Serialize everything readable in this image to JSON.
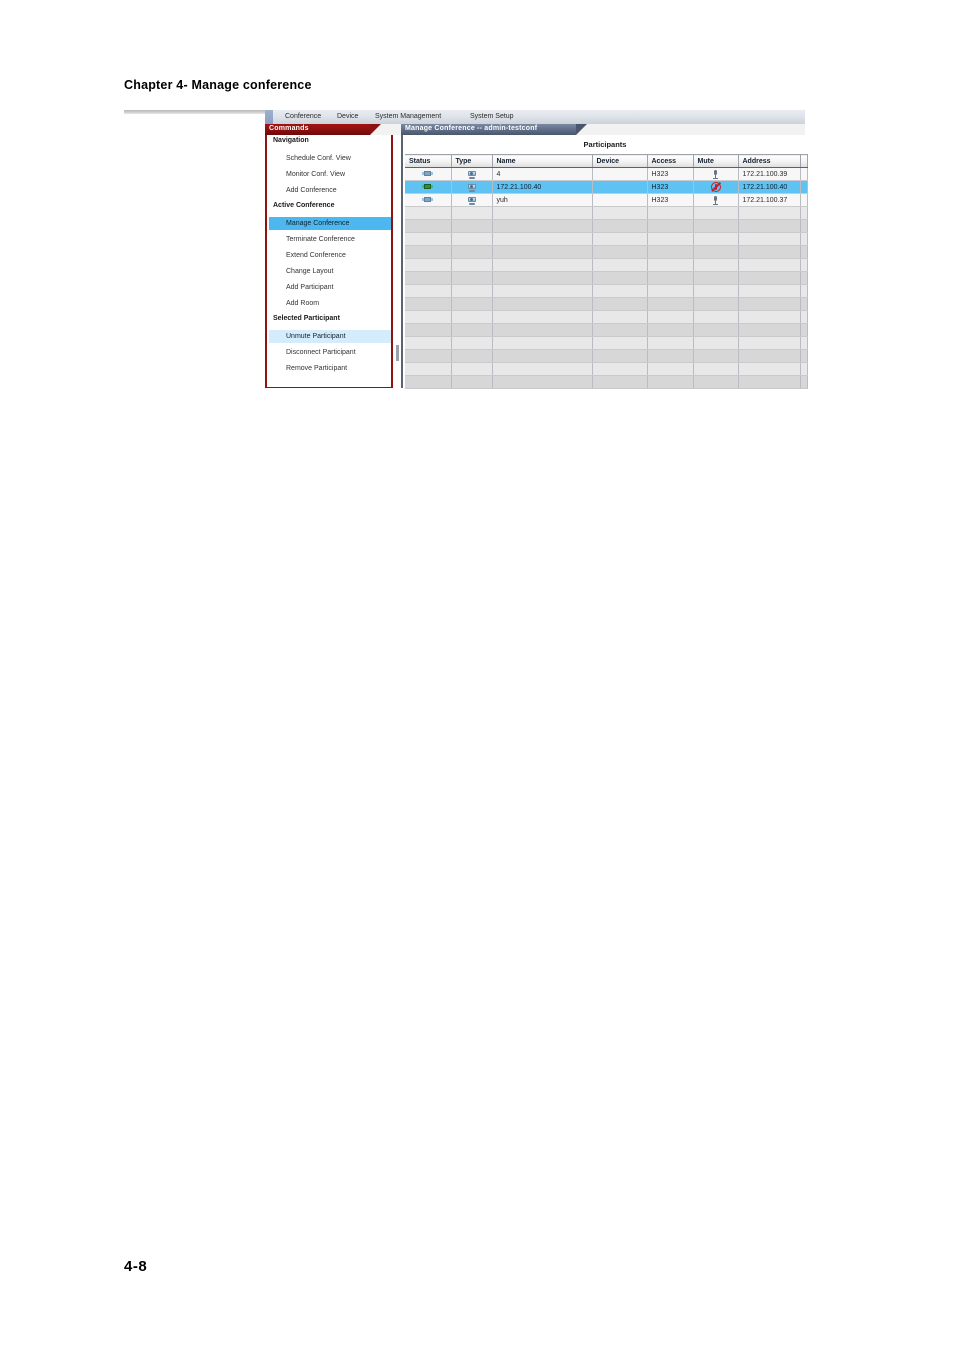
{
  "page": {
    "chapter_title": "Chapter 4- Manage conference",
    "page_number": "4-8"
  },
  "app": {
    "menubar": {
      "items": [
        {
          "label": "Conference"
        },
        {
          "label": "Device"
        },
        {
          "label": "System Management"
        },
        {
          "label": "System Setup"
        }
      ]
    },
    "tabs": {
      "commands": "Commands",
      "content": "Manage Conference -- admin-testconf"
    },
    "commands_panel": {
      "groups": [
        {
          "title": "Navigation",
          "items": [
            {
              "label": "Schedule Conf. View",
              "state": "normal"
            },
            {
              "label": "Monitor Conf. View",
              "state": "normal"
            },
            {
              "label": "Add Conference",
              "state": "normal"
            }
          ]
        },
        {
          "title": "Active Conference",
          "items": [
            {
              "label": "Manage Conference",
              "state": "selected"
            },
            {
              "label": "Terminate Conference",
              "state": "normal"
            },
            {
              "label": "Extend Conference",
              "state": "normal"
            },
            {
              "label": "Change Layout",
              "state": "normal"
            },
            {
              "label": "Add Participant",
              "state": "normal"
            },
            {
              "label": "Add Room",
              "state": "normal"
            }
          ]
        },
        {
          "title": "Selected Participant",
          "items": [
            {
              "label": "Unmute Participant",
              "state": "highlight"
            },
            {
              "label": "Disconnect Participant",
              "state": "normal"
            },
            {
              "label": "Remove Participant",
              "state": "normal"
            }
          ]
        }
      ]
    },
    "content_panel": {
      "caption": "Participants",
      "table": {
        "columns": [
          "Status",
          "Type",
          "Name",
          "Device",
          "Access",
          "Mute",
          "Address",
          ""
        ],
        "rows": [
          {
            "status_icon": "connected-dim-icon",
            "type_icon": "endpoint-device-icon",
            "name": "4",
            "device": "",
            "access": "H323",
            "mute_icon": "microphone-icon",
            "address": "172.21.100.39",
            "selected": false
          },
          {
            "status_icon": "connected-green-icon",
            "type_icon": "endpoint-device-icon",
            "name": "172.21.100.40",
            "device": "",
            "access": "H323",
            "mute_icon": "muted-icon",
            "address": "172.21.100.40",
            "selected": true
          },
          {
            "status_icon": "connected-dim-icon",
            "type_icon": "endpoint-device-icon",
            "name": "yuh",
            "device": "",
            "access": "H323",
            "mute_icon": "microphone-icon",
            "address": "172.21.100.37",
            "selected": false
          }
        ],
        "empty_row_count": 14
      }
    },
    "colors": {
      "commands_tab": "#8e0f0f",
      "content_tab": "#4a566c",
      "selection": "#5ec2f2",
      "nav_selected": "#4db8ef",
      "nav_highlight": "#d4ecfb",
      "mute_red": "#cc1e1e",
      "status_green": "#2f8f3d"
    }
  }
}
